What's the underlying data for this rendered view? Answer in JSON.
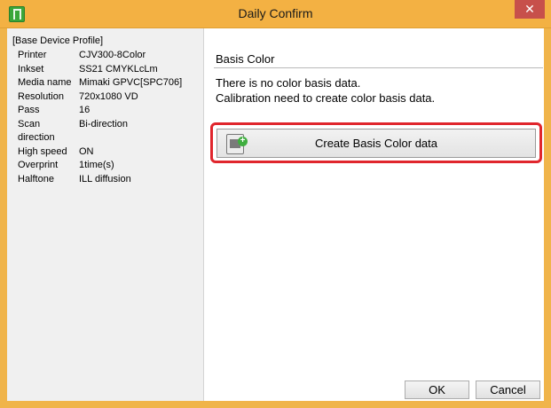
{
  "window": {
    "title": "Daily Confirm",
    "close_label": "✕",
    "app_icon": "mimaki-app-icon"
  },
  "profile": {
    "title": "[Base Device Profile]",
    "rows": [
      {
        "key": "Printer",
        "value": "CJV300-8Color"
      },
      {
        "key": "Inkset",
        "value": "SS21 CMYKLcLm"
      },
      {
        "key": "Media name",
        "value": "Mimaki GPVC[SPC706]"
      },
      {
        "key": "Resolution",
        "value": "720x1080 VD"
      },
      {
        "key": "Pass",
        "value": "16"
      },
      {
        "key": "Scan direction",
        "value": "Bi-direction"
      },
      {
        "key": "High speed",
        "value": "ON"
      },
      {
        "key": "Overprint",
        "value": "1time(s)"
      },
      {
        "key": "Halftone",
        "value": "ILL diffusion"
      }
    ]
  },
  "main": {
    "section_title": "Basis Color",
    "message_line1": "There is no color basis data.",
    "message_line2": "Calibration need to create color basis data.",
    "create_button_label": "Create Basis Color data"
  },
  "footer": {
    "ok_label": "OK",
    "cancel_label": "Cancel"
  },
  "colors": {
    "titlebar": "#f3b143",
    "highlight": "#e0262d",
    "close": "#c7504b"
  }
}
